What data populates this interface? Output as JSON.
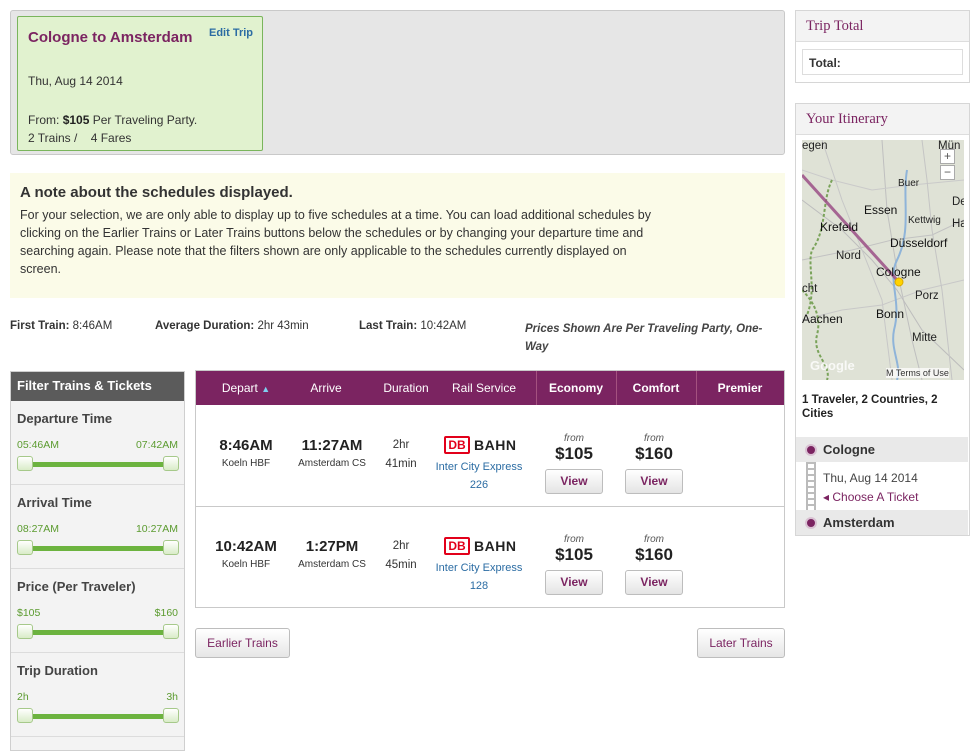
{
  "trip": {
    "route": "Cologne to Amsterdam",
    "edit_label": "Edit Trip",
    "date": "Thu, Aug 14 2014",
    "from_prefix": "From:",
    "from_price": "$105",
    "from_suffix": "Per Traveling Party.",
    "counts": "2 Trains /    4 Fares"
  },
  "note": {
    "title": "A note about the schedules displayed.",
    "body": "For your selection, we are only able to display up to five schedules at a time. You can load additional schedules by clicking on the Earlier Trains or Later Trains buttons below the schedules or by changing your departure time and searching again. Please note that the filters shown are only applicable to the schedules currently displayed on screen."
  },
  "summary": {
    "first_label": "First Train:",
    "first_value": "8:46AM",
    "avg_label": "Average Duration:",
    "avg_value": "2hr 43min",
    "last_label": "Last Train:",
    "last_value": "10:42AM",
    "prices_note": "Prices Shown Are Per Traveling Party, One-Way"
  },
  "filters": {
    "heading": "Filter Trains & Tickets",
    "blocks": [
      {
        "title": "Departure Time",
        "min": "05:46AM",
        "max": "07:42AM"
      },
      {
        "title": "Arrival Time",
        "min": "08:27AM",
        "max": "10:27AM"
      },
      {
        "title": "Price (Per Traveler)",
        "min": "$105",
        "max": "$160"
      },
      {
        "title": "Trip Duration",
        "min": "2h",
        "max": "3h"
      }
    ]
  },
  "table": {
    "headers": {
      "depart": "Depart",
      "sort_icon": "▲",
      "arrive": "Arrive",
      "duration": "Duration",
      "rail": "Rail Service",
      "economy": "Economy",
      "comfort": "Comfort",
      "premier": "Premier"
    },
    "rows": [
      {
        "depart_time": "8:46AM",
        "depart_station": "Koeln HBF",
        "arrive_time": "11:27AM",
        "arrive_station": "Amsterdam CS",
        "dur_hr": "2hr",
        "dur_min": "41min",
        "service_line1": "Inter City Express",
        "service_line2": "226",
        "economy_from": "from",
        "economy_price": "$105",
        "economy_btn": "View",
        "comfort_from": "from",
        "comfort_price": "$160",
        "comfort_btn": "View"
      },
      {
        "depart_time": "10:42AM",
        "depart_station": "Koeln HBF",
        "arrive_time": "1:27PM",
        "arrive_station": "Amsterdam CS",
        "dur_hr": "2hr",
        "dur_min": "45min",
        "service_line1": "Inter City Express",
        "service_line2": "128",
        "economy_from": "from",
        "economy_price": "$105",
        "economy_btn": "View",
        "comfort_from": "from",
        "comfort_price": "$160",
        "comfort_btn": "View"
      }
    ],
    "logo_db": "DB",
    "logo_bahn": "BAHN"
  },
  "nav": {
    "earlier": "Earlier Trains",
    "later": "Later Trains"
  },
  "trip_total": {
    "title": "Trip Total",
    "total_label": "Total:"
  },
  "itinerary": {
    "title": "Your Itinerary",
    "summary": "1 Traveler, 2 Countries, 2 Cities",
    "origin": "Cologne",
    "origin_date": "Thu, Aug 14 2014",
    "choose_ticket": "◂ Choose A Ticket",
    "destination": "Amsterdam",
    "map": {
      "cities": [
        "Essen",
        "Krefeld",
        "Düsseldorf",
        "Cologne",
        "Bonn",
        "Aachen"
      ],
      "places": [
        "egen",
        "Mün",
        "Buer",
        "Kettwig",
        "Nord",
        "De",
        "Ha",
        "Porz",
        "Mitte",
        "cht"
      ],
      "zoom_in": "+",
      "zoom_out": "−",
      "attribution": "M Terms of Use",
      "google": "Google",
      "route_color": "#9b4f86",
      "marker_color": "#ffd200"
    }
  },
  "colors": {
    "brand": "#7b2461",
    "accent_green": "#6cb33f",
    "link_blue": "#2b6ca3"
  }
}
